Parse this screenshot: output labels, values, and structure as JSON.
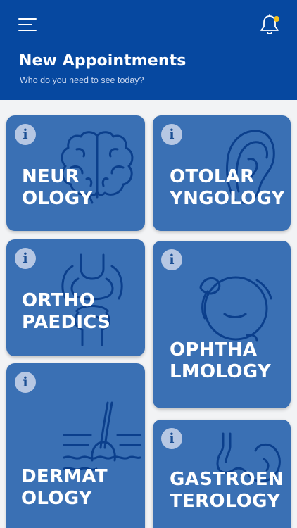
{
  "header": {
    "title": "New Appointments",
    "subtitle": "Who do you need to see today?",
    "menu_icon": "hamburger-menu-icon",
    "bell_icon": "notification-bell-icon",
    "notification_dot_color": "#f6c21b",
    "background_color": "#0648a0"
  },
  "cards": {
    "neurology": {
      "line1": "NEUR",
      "line2": "OLOGY",
      "info": "i",
      "icon": "brain-icon"
    },
    "otolaryngology": {
      "line1": "OTOLAR",
      "line2": "YNGOLOGY",
      "info": "i",
      "icon": "ear-icon"
    },
    "orthopaedics": {
      "line1": "ORTHO",
      "line2": "PAEDICS",
      "info": "i",
      "icon": "joint-bone-icon"
    },
    "ophthalmology": {
      "line1": "OPHTHA",
      "line2": "LMOLOGY",
      "info": "i",
      "icon": "eyeball-icon"
    },
    "dermatology": {
      "line1": "DERMAT",
      "line2": "OLOGY",
      "info": "i",
      "icon": "skin-hair-icon"
    },
    "gastroenterology": {
      "line1": "GASTROEN",
      "line2": "TEROLOGY",
      "info": "i",
      "icon": "stomach-icon"
    }
  },
  "colors": {
    "card_background": "#3a70b4",
    "card_outline_art": "#0b3f8c",
    "info_badge": "#b6c7e3"
  }
}
